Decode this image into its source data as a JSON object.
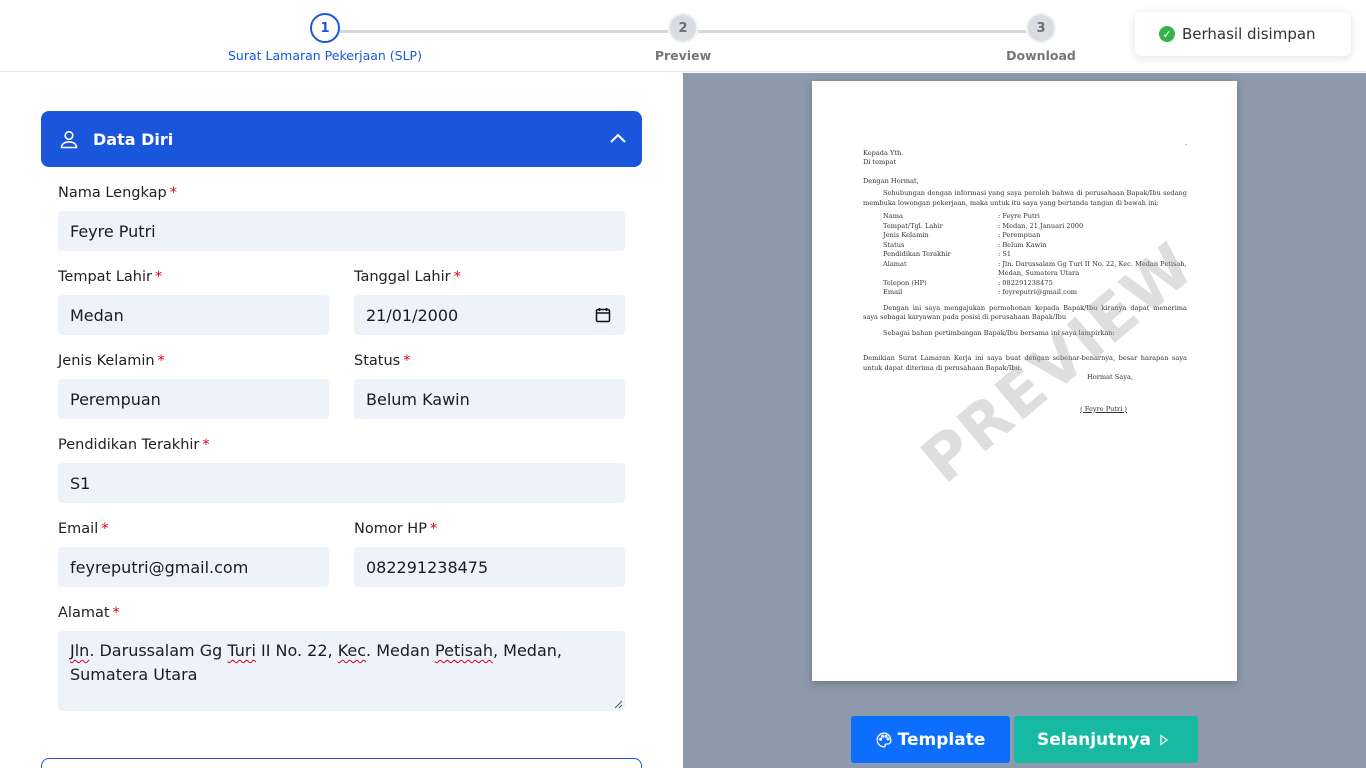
{
  "stepper": {
    "steps": [
      {
        "number": "1",
        "label": "Surat Lamaran Pekerjaan (SLP)"
      },
      {
        "number": "2",
        "label": "Preview"
      },
      {
        "number": "3",
        "label": "Download"
      }
    ]
  },
  "toast": {
    "message": "Berhasil disimpan"
  },
  "section": {
    "title": "Data Diri"
  },
  "form": {
    "nama": {
      "label": "Nama Lengkap",
      "value": "Feyre Putri"
    },
    "tempat_lahir": {
      "label": "Tempat Lahir",
      "value": "Medan"
    },
    "tanggal_lahir": {
      "label": "Tanggal Lahir",
      "value": "21/01/2000"
    },
    "jenis_kelamin": {
      "label": "Jenis Kelamin",
      "value": "Perempuan"
    },
    "status": {
      "label": "Status",
      "value": "Belum Kawin"
    },
    "pendidikan": {
      "label": "Pendidikan Terakhir",
      "value": "S1"
    },
    "email": {
      "label": "Email",
      "value": "feyreputri@gmail.com"
    },
    "nomor_hp": {
      "label": "Nomor HP",
      "value": "082291238475"
    },
    "alamat": {
      "label": "Alamat",
      "value_parts": [
        "Jln",
        ". Darussalam Gg ",
        "Turi",
        " II No. 22, ",
        "Kec",
        ". Medan ",
        "Petisah",
        ", Medan,",
        "Sumatera Utara"
      ]
    },
    "required_mark": "*"
  },
  "letter": {
    "dot": ".",
    "to": "Kepada Yth.",
    "place": "Di tempat",
    "greeting": "Dengan Hormat,",
    "intro": "Sehubungan dengan informasi yang saya peroleh bahwa di perusahaan Bapak/Ibu sedang membuka lowongan pekerjaan, maka untuk itu saya yang bertanda tangan di bawah ini:",
    "rows": [
      {
        "k": "Nama",
        "v": ": Feyre Putri"
      },
      {
        "k": "Tempat/Tgl. Lahir",
        "v": ": Medan, 21 Januari 2000"
      },
      {
        "k": "Jenis Kelamin",
        "v": ": Perempuan"
      },
      {
        "k": "Status",
        "v": ": Belum Kawin"
      },
      {
        "k": "Pendidikan Terakhir",
        "v": ": S1"
      },
      {
        "k": "Alamat",
        "v": ": Jln. Darussalam Gg Turi II No. 22, Kec. Medan Petisah, Medan, Sumatera Utara"
      },
      {
        "k": "Telepon (HP)",
        "v": ": 082291238475"
      },
      {
        "k": "Email",
        "v": ": feyreputri@gmail.com"
      }
    ],
    "para1": "Dengan ini saya mengajukan permohonan kepada Bapak/Ibu kiranya dapat menerima saya sebagai karyawan pada posisi di perusahaan Bapak/Ibu",
    "para2": "Sebagai bahan pertimbangan Bapak/Ibu bersama ini saya lampirkan:",
    "closing": "Demikian Surat Lamaran Kerja ini saya buat dengan sebenar-benarnya, besar harapan saya untuk dapat diterima di perusahaan Bapak/Ibu.",
    "regards": "Hormat Saya,",
    "signature": "( Feyre Putri )",
    "watermark": "PREVIEW"
  },
  "buttons": {
    "template": "Template",
    "next": "Selanjutnya"
  },
  "colors": {
    "primary": "#1a56db",
    "teal": "#17b9a2",
    "field_bg": "#eef2fb",
    "preview_bg": "#8e9aab"
  }
}
